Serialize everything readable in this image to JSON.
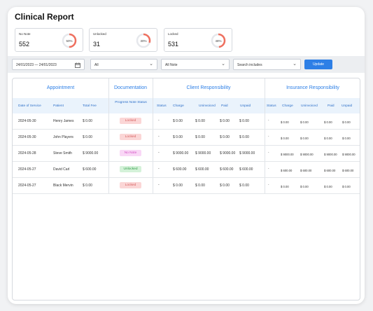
{
  "page": {
    "title": "Clinical Report"
  },
  "stats": [
    {
      "label": "No Note",
      "value": "552",
      "percent_label": "50%",
      "percent": 50,
      "ring_color": "#ef6f5e"
    },
    {
      "label": "Unlocked",
      "value": "31",
      "percent_label": "30%",
      "percent": 30,
      "ring_color": "#ef6f5e"
    },
    {
      "label": "Locked",
      "value": "531",
      "percent_label": "48%",
      "percent": 48,
      "ring_color": "#ef6f5e"
    }
  ],
  "filters": {
    "date_range": "24/01/2023 — 24/01/2023",
    "filter1": "All",
    "filter2": "All Note",
    "search": "Search includes",
    "update_label": "Update"
  },
  "table": {
    "groups": {
      "appointment": "Appointment",
      "documentation": "Documentation",
      "client": "Client Responsibility",
      "insurance": "Insurance Responsibility"
    },
    "columns": {
      "date": "Date of Service",
      "patient": "Patient",
      "total_fee": "Total Fee",
      "progress": "Progress Note Status",
      "c_status": "Status",
      "c_charge": "Charge",
      "c_uninvoiced": "Uninvoiced",
      "c_paid": "Paid",
      "c_unpaid": "Unpaid",
      "i_status": "Status",
      "i_charge": "Charge",
      "i_uninvoiced": "Uninvoiced",
      "i_paid": "Paid",
      "i_unpaid": "Unpaid"
    },
    "rows": [
      {
        "date": "2024-05-30",
        "patient": "Henry James",
        "fee": "$ 0.00",
        "status": "Locked",
        "status_type": "locked",
        "c_status": "-",
        "c_charge": "$ 0.00",
        "c_uninvoiced": "$ 0.00",
        "c_paid": "$ 0.00",
        "c_unpaid": "$ 0.00",
        "i_status": "-",
        "i_charge": "$ 0.00",
        "i_uninvoiced": "$ 0.00",
        "i_paid": "$ 0.00",
        "i_unpaid": "$ 0.00"
      },
      {
        "date": "2024-05-30",
        "patient": "John Players",
        "fee": "$ 0.00",
        "status": "Locked",
        "status_type": "locked",
        "c_status": "-",
        "c_charge": "$ 0.00",
        "c_uninvoiced": "$ 0.00",
        "c_paid": "$ 0.00",
        "c_unpaid": "$ 0.00",
        "i_status": "-",
        "i_charge": "$ 0.00",
        "i_uninvoiced": "$ 0.00",
        "i_paid": "$ 0.00",
        "i_unpaid": "$ 0.00"
      },
      {
        "date": "2024-05-28",
        "patient": "Steve Smith",
        "fee": "$ 9000.00",
        "status": "No Note",
        "status_type": "nonote",
        "c_status": "-",
        "c_charge": "$ 9000.00",
        "c_uninvoiced": "$ 9000.00",
        "c_paid": "$ 9000.00",
        "c_unpaid": "$ 9000.00",
        "i_status": "-",
        "i_charge": "$ 9000.00",
        "i_uninvoiced": "$ 9000.00",
        "i_paid": "$ 9000.00",
        "i_unpaid": "$ 9000.00"
      },
      {
        "date": "2024-05-27",
        "patient": "David Carl",
        "fee": "$ 600.00",
        "status": "Unlocked",
        "status_type": "unlocked",
        "c_status": "-",
        "c_charge": "$ 600.00",
        "c_uninvoiced": "$ 600.00",
        "c_paid": "$ 600.00",
        "c_unpaid": "$ 600.00",
        "i_status": "-",
        "i_charge": "$ 600.00",
        "i_uninvoiced": "$ 600.00",
        "i_paid": "$ 600.00",
        "i_unpaid": "$ 600.00"
      },
      {
        "date": "2024-05-27",
        "patient": "Black Mervin",
        "fee": "$ 0.00",
        "status": "Locked",
        "status_type": "locked",
        "c_status": "-",
        "c_charge": "$ 0.00",
        "c_uninvoiced": "$ 0.00",
        "c_paid": "$ 0.00",
        "c_unpaid": "$ 0.00",
        "i_status": "-",
        "i_charge": "$ 0.00",
        "i_uninvoiced": "$ 0.00",
        "i_paid": "$ 0.00",
        "i_unpaid": "$ 0.00"
      }
    ]
  },
  "colors": {
    "accent": "#2d7fe6",
    "locked": "#d45b5b",
    "nonote": "#d24ec2",
    "unlocked": "#2d9a44"
  }
}
